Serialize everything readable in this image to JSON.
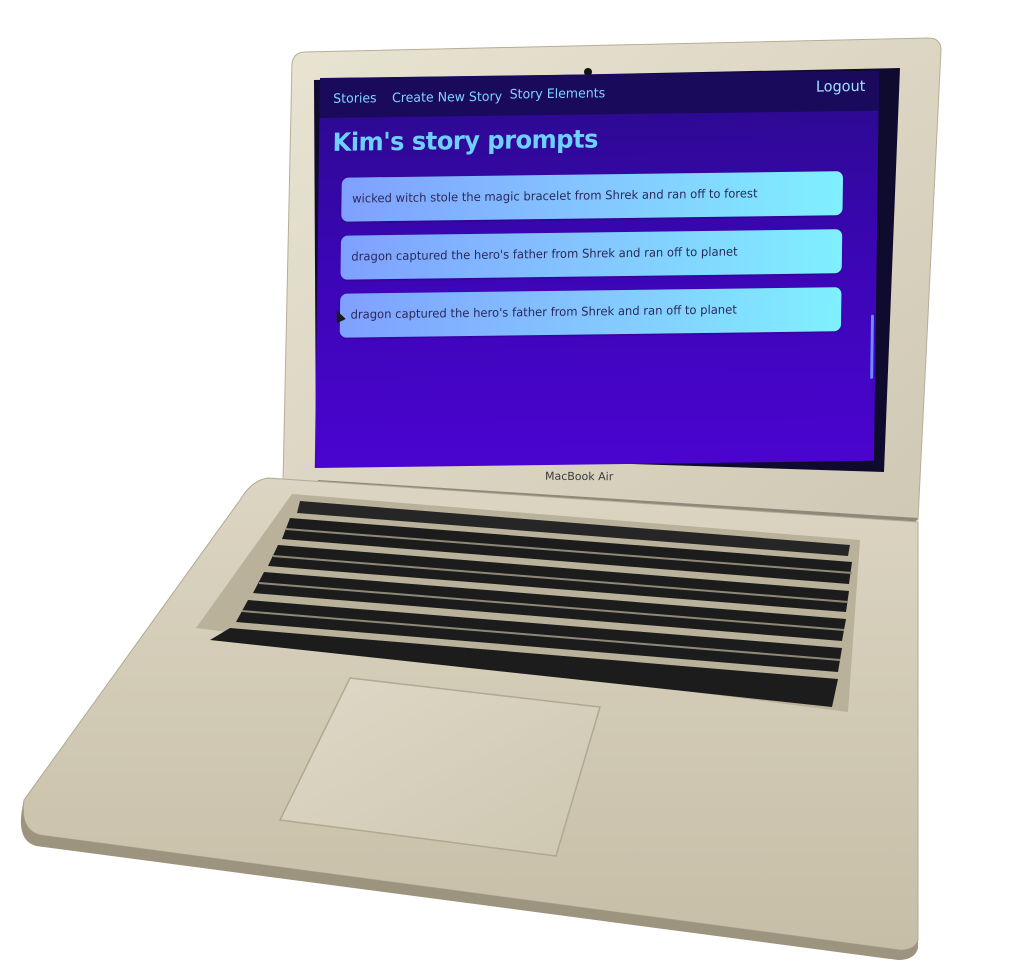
{
  "app": {
    "nav": {
      "stories": "Stories",
      "create_new_story": "Create New Story",
      "story_elements": "Story Elements",
      "logout": "Logout"
    },
    "page_title": "Kim's story prompts",
    "prompts": [
      {
        "text": "wicked witch stole the magic bracelet from Shrek and ran off to forest"
      },
      {
        "text": "dragon captured the hero's father from Shrek and ran off to planet"
      },
      {
        "text": "dragon captured the hero's father from Shrek and ran off to planet"
      }
    ]
  },
  "device": {
    "brand_label": "MacBook Air"
  },
  "colors": {
    "screen_bg": "#3a06b3",
    "nav_bg": "#1a0a5c",
    "nav_link": "#7fd3ff",
    "title": "#6fcfff",
    "card_gradient_start": "#7fa0ff",
    "card_gradient_end": "#7ff0ff"
  }
}
